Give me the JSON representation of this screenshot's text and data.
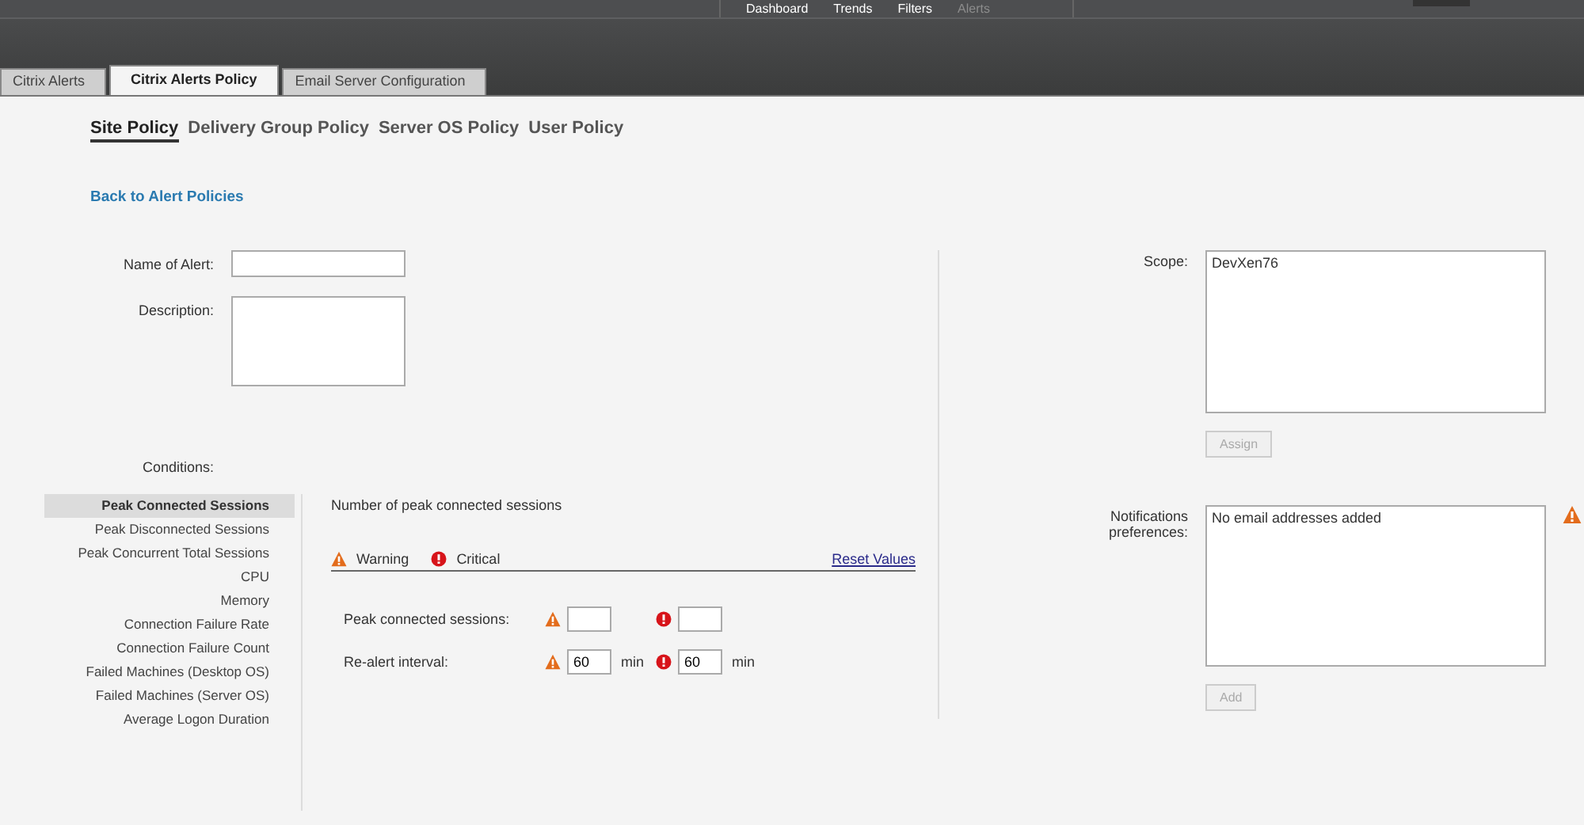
{
  "header": {
    "nav": [
      {
        "label": "Dashboard",
        "selected": false
      },
      {
        "label": "Trends",
        "selected": false
      },
      {
        "label": "Filters",
        "selected": false
      },
      {
        "label": "Alerts",
        "selected": true
      }
    ]
  },
  "tabs": [
    {
      "label": "Citrix Alerts",
      "selected": false
    },
    {
      "label": "Citrix Alerts Policy",
      "selected": true
    },
    {
      "label": "Email Server Configuration",
      "selected": false
    }
  ],
  "policy_tabs": [
    {
      "label": "Site Policy",
      "selected": true
    },
    {
      "label": "Delivery Group Policy",
      "selected": false
    },
    {
      "label": "Server OS Policy",
      "selected": false
    },
    {
      "label": "User Policy",
      "selected": false
    }
  ],
  "back_link": "Back to Alert Policies",
  "form": {
    "name_label": "Name of Alert:",
    "description_label": "Description:",
    "conditions_label": "Conditions:"
  },
  "conditions": [
    {
      "label": "Peak Connected Sessions",
      "selected": true
    },
    {
      "label": "Peak Disconnected Sessions",
      "selected": false
    },
    {
      "label": "Peak Concurrent Total Sessions",
      "selected": false
    },
    {
      "label": "CPU",
      "selected": false
    },
    {
      "label": "Memory",
      "selected": false
    },
    {
      "label": "Connection Failure Rate",
      "selected": false
    },
    {
      "label": "Connection Failure Count",
      "selected": false
    },
    {
      "label": "Failed Machines (Desktop OS)",
      "selected": false
    },
    {
      "label": "Failed Machines (Server OS)",
      "selected": false
    },
    {
      "label": "Average Logon Duration",
      "selected": false
    }
  ],
  "condition_panel": {
    "title": "Number of peak connected sessions",
    "legend": [
      {
        "kind": "warning",
        "label": "Warning"
      },
      {
        "kind": "critical",
        "label": "Critical"
      }
    ],
    "reset_link": "Reset Values",
    "rows": [
      {
        "label": "Peak connected sessions:"
      },
      {
        "label": "Re-alert interval:",
        "warning_value": "60",
        "warning_unit": "min",
        "critical_value": "60",
        "critical_unit": "min"
      }
    ]
  },
  "scope": {
    "label": "Scope:",
    "items": [
      "DevXen76"
    ],
    "button": {
      "label": "Assign",
      "disabled": true
    }
  },
  "notifications": {
    "label": "Notifications preferences:",
    "items": [
      "No email addresses added"
    ],
    "warning": true,
    "button": {
      "label": "Add",
      "disabled": true
    }
  }
}
